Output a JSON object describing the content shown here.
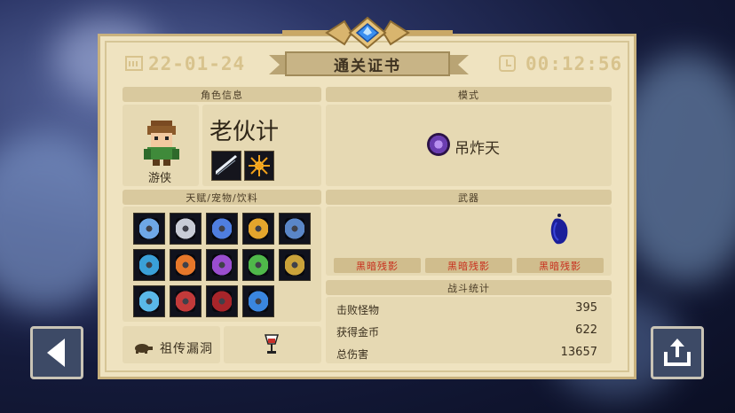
{
  "certificate": {
    "date": "22-01-24",
    "title": "通关证书",
    "time": "00:12:56"
  },
  "character": {
    "header": "角色信息",
    "class_name": "游侠",
    "player_name": "老伙计",
    "skills": [
      "slash-skill-icon",
      "spark-skill-icon"
    ]
  },
  "mode": {
    "header": "模式",
    "icon": "demon-mode-icon",
    "name": "吊炸天"
  },
  "buffs": {
    "header": "天赋/宠物/饮料",
    "icons": [
      "shield-buff-icon",
      "silver-shield-buff-icon",
      "blue-shield-buff-icon",
      "gold-shield-buff-icon",
      "armor-chest-buff-icon",
      "crosshair-buff-icon",
      "fire-shield-buff-icon",
      "purple-shield-buff-icon",
      "green-shield-buff-icon",
      "gun-buff-icon",
      "blade-buff-icon",
      "claw-buff-icon",
      "bat-buff-icon",
      "brain-buff-icon"
    ]
  },
  "weapons": {
    "header": "武器",
    "items": [
      "黑暗残影",
      "黑暗残影",
      "黑暗残影"
    ]
  },
  "battle_stats": {
    "header": "战斗统计",
    "rows": [
      {
        "label": "击败怪物",
        "value": "395"
      },
      {
        "label": "获得金币",
        "value": "622"
      },
      {
        "label": "总伤害",
        "value": "13657"
      }
    ]
  },
  "relic": {
    "name": "祖传漏洞"
  },
  "colors": {
    "card": "#efe3c0",
    "header": "#d9c99e",
    "weapon_text": "#c8301e"
  }
}
